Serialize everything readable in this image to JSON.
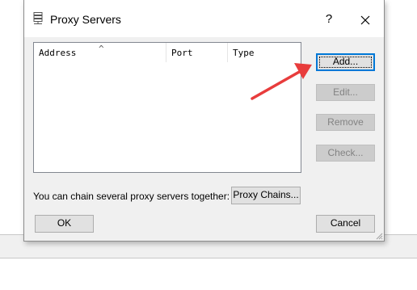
{
  "window": {
    "title": "Proxy Servers",
    "help_label": "?"
  },
  "table": {
    "columns": [
      "Address",
      "Port",
      "Type"
    ],
    "sort_indicator": "^",
    "rows": []
  },
  "side_buttons": {
    "add": "Add...",
    "edit": "Edit...",
    "remove": "Remove",
    "check": "Check..."
  },
  "chain": {
    "text": "You can chain several proxy servers together:",
    "button": "Proxy Chains..."
  },
  "footer": {
    "ok": "OK",
    "cancel": "Cancel"
  },
  "colors": {
    "annotation_arrow": "#e83c3c",
    "default_button_border": "#0078d7"
  }
}
